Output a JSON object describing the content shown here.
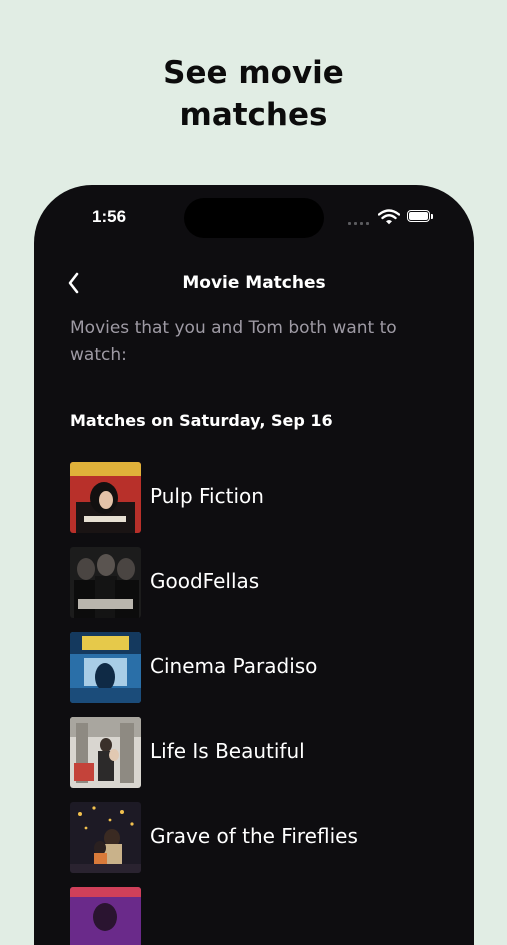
{
  "headline": {
    "line1": "See movie",
    "line2": "matches"
  },
  "status_bar": {
    "time": "1:56"
  },
  "nav": {
    "title": "Movie Matches",
    "back_icon": "chevron-left-icon"
  },
  "subtitle": "Movies that you and Tom both want to watch:",
  "section_heading": "Matches on Saturday, Sep 16",
  "movies": [
    {
      "title": "Pulp Fiction",
      "poster_color": "#b8302a"
    },
    {
      "title": "GoodFellas",
      "poster_color": "#1c1c1c"
    },
    {
      "title": "Cinema Paradiso",
      "poster_color": "#2a6fa8"
    },
    {
      "title": "Life Is Beautiful",
      "poster_color": "#d9d6d0"
    },
    {
      "title": "Grave of the Fireflies",
      "poster_color": "#1d1a25"
    },
    {
      "title": "",
      "poster_color": "#6a2a8a"
    }
  ],
  "colors": {
    "page_background": "#e1ede4",
    "phone_background": "#0e0d10",
    "subtitle_text": "#9e9aa4"
  }
}
